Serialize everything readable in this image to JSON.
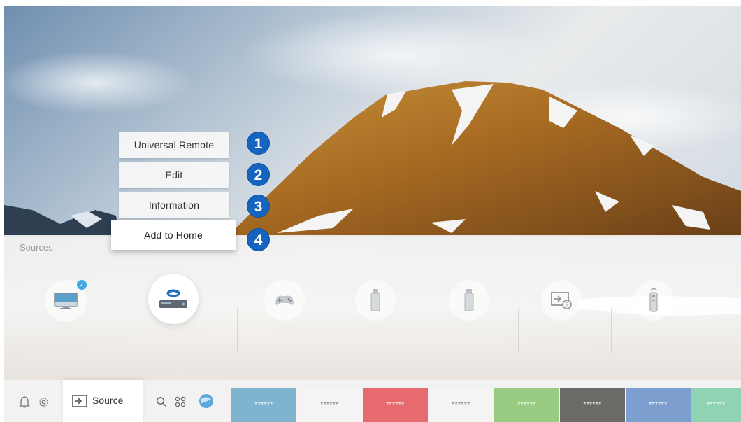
{
  "menu": {
    "items": [
      {
        "label": "Universal Remote",
        "number": "1"
      },
      {
        "label": "Edit",
        "number": "2"
      },
      {
        "label": "Information",
        "number": "3"
      },
      {
        "label": "Add to Home",
        "number": "4"
      }
    ]
  },
  "sources": {
    "label": "Sources",
    "items": [
      {
        "icon": "tv-icon",
        "checked": true
      },
      {
        "icon": "bluray-player-icon",
        "selected": true
      },
      {
        "icon": "game-console-icon"
      },
      {
        "icon": "usb-drive-icon"
      },
      {
        "icon": "usb-drive-icon"
      },
      {
        "icon": "connection-guide-icon"
      },
      {
        "icon": "remote-control-icon"
      }
    ]
  },
  "bottom_bar": {
    "source_label": "Source",
    "left_icons": [
      "bell-icon",
      "gear-icon"
    ],
    "middle_icons": [
      "search-icon",
      "apps-icon",
      "globe-icon"
    ],
    "tiles": [
      {
        "label": "******",
        "color": "#7fb4cf",
        "text_color": "#ffffff"
      },
      {
        "label": "******",
        "color": "#f4f4f4",
        "text_color": "#777777"
      },
      {
        "label": "******",
        "color": "#e66a6e",
        "text_color": "#ffffff"
      },
      {
        "label": "******",
        "color": "#f4f4f4",
        "text_color": "#777777"
      },
      {
        "label": "******",
        "color": "#98cc82",
        "text_color": "#ffffff"
      },
      {
        "label": "******",
        "color": "#6b6a66",
        "text_color": "#ffffff"
      },
      {
        "label": "******",
        "color": "#7c9fd0",
        "text_color": "#ffffff"
      },
      {
        "label": "******",
        "color": "#8fd3b2",
        "text_color": "#ffffff"
      }
    ]
  },
  "colors": {
    "badge": "#1565c0",
    "accent_check": "#3fa9e0"
  }
}
